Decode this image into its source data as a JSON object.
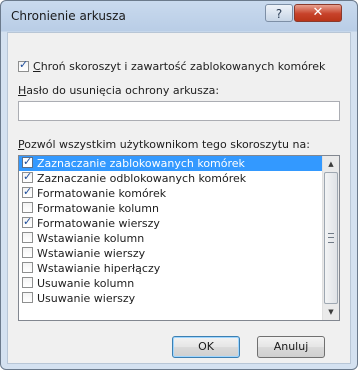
{
  "window": {
    "title": "Chronienie arkusza",
    "help_glyph": "?",
    "close_glyph": "✕"
  },
  "protect_checkbox": {
    "checked": true,
    "label_access": "C",
    "label_rest": "hroń skoroszyt i zawartość zablokowanych komórek"
  },
  "password": {
    "label_access": "H",
    "label_rest": "asło do usunięcia ochrony arkusza:",
    "value": ""
  },
  "permissions": {
    "label_access": "P",
    "label_rest": "ozwól wszystkim użytkownikom tego skoroszytu na:",
    "items": [
      {
        "label": "Zaznaczanie zablokowanych komórek",
        "checked": true,
        "selected": true
      },
      {
        "label": "Zaznaczanie odblokowanych komórek",
        "checked": true,
        "selected": false
      },
      {
        "label": "Formatowanie komórek",
        "checked": true,
        "selected": false
      },
      {
        "label": "Formatowanie kolumn",
        "checked": false,
        "selected": false
      },
      {
        "label": "Formatowanie wierszy",
        "checked": true,
        "selected": false
      },
      {
        "label": "Wstawianie kolumn",
        "checked": false,
        "selected": false
      },
      {
        "label": "Wstawianie wierszy",
        "checked": false,
        "selected": false
      },
      {
        "label": "Wstawianie hiperłączy",
        "checked": false,
        "selected": false
      },
      {
        "label": "Usuwanie kolumn",
        "checked": false,
        "selected": false
      },
      {
        "label": "Usuwanie wierszy",
        "checked": false,
        "selected": false
      }
    ]
  },
  "buttons": {
    "ok": "OK",
    "cancel": "Anuluj"
  },
  "colors": {
    "selection": "#3399ff",
    "close_button": "#c7422a",
    "title_bar": "#c9daee"
  }
}
